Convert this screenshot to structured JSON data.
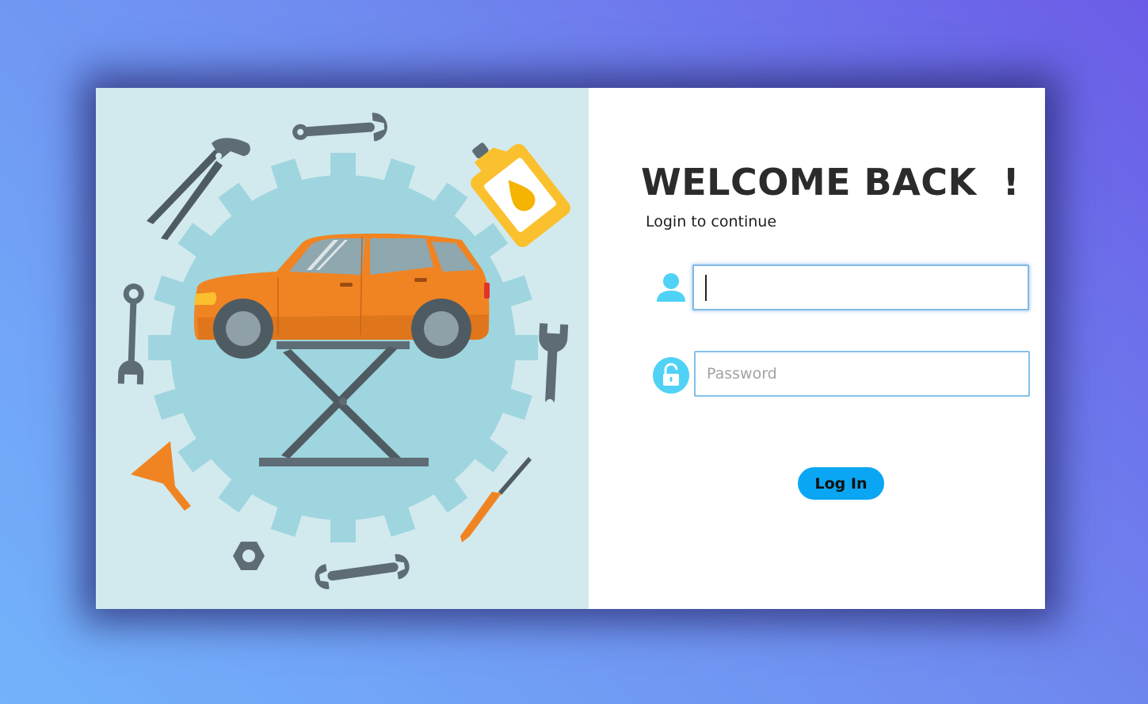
{
  "login": {
    "title": "WELCOME BACK  !",
    "subtitle": "Login to continue",
    "username": {
      "value": "",
      "placeholder": "",
      "icon": "user-icon"
    },
    "password": {
      "value": "",
      "placeholder": "Password",
      "icon": "lock-icon"
    },
    "submit_label": "Log In"
  },
  "illustration": {
    "subject": "car-on-lift-with-tools",
    "icons": [
      "car-icon",
      "car-lift-icon",
      "gear-icon",
      "pliers-icon",
      "wrench-icon",
      "oil-bottle-icon",
      "funnel-icon",
      "screwdriver-icon",
      "hex-nut-icon",
      "adjustable-wrench-icon"
    ]
  },
  "colors": {
    "accent": "#0aa6f3",
    "icon_cyan": "#4fd2f5",
    "illustration_bg": "#d2eaee",
    "gear": "#9fd5de",
    "car_body": "#f08423",
    "tool_grey": "#5e6d75",
    "oil_bottle": "#fbc02d"
  }
}
